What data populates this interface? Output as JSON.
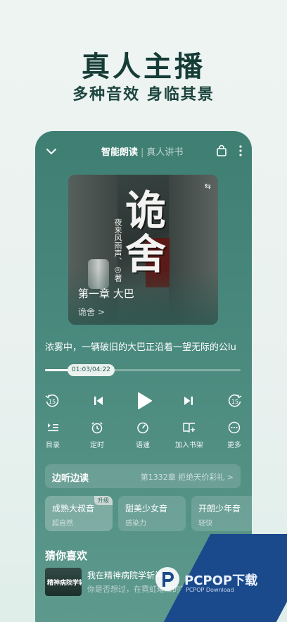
{
  "headline": "真人主播",
  "subhead": "多种音效 身临其景",
  "player": {
    "tabs": {
      "active": "智能朗读",
      "inactive": "真人讲书"
    },
    "cover": {
      "title_art": "诡舍",
      "author": "夜来风雨声、◎著",
      "chapter": "第一章 大巴",
      "book_link": "诡舍 >",
      "corner_mark": "⇆"
    },
    "current_line": "浓雾中，一辆破旧的大巴正沿着一望无际的公lu",
    "progress": {
      "time": "01:03/04:22",
      "fraction": 0.24
    },
    "controls": {
      "back15": "15",
      "forward15": "15"
    },
    "actions": [
      {
        "label": "目录",
        "icon": "playlist-icon"
      },
      {
        "label": "定时",
        "icon": "alarm-icon"
      },
      {
        "label": "语速",
        "icon": "speed-icon"
      },
      {
        "label": "加入书架",
        "icon": "bookshelf-add-icon"
      },
      {
        "label": "更多",
        "icon": "more-circle-icon"
      }
    ],
    "listen_read": {
      "label": "边听边读",
      "right": "第1332章 拒绝天价彩礼 >"
    },
    "voices": [
      {
        "name": "成熟大叔音",
        "desc": "超自然",
        "badge": "升级"
      },
      {
        "name": "甜美少女音",
        "desc": "感染力",
        "badge": ""
      },
      {
        "name": "开朗少年音",
        "desc": "轻快",
        "badge": ""
      }
    ],
    "guess_title": "猜你喜欢",
    "recommend": {
      "thumb_text": "精神病院学斩神",
      "title": "我在精神病院学斩神",
      "desc": "你是否想过，在霓虹璀璨的都市"
    }
  },
  "watermark": {
    "main": "PCPOP下载",
    "sub": "PCPOP Download"
  },
  "colors": {
    "panel": "#4b8a7e",
    "headline": "#163c36",
    "accent": "#1b4a8c"
  }
}
